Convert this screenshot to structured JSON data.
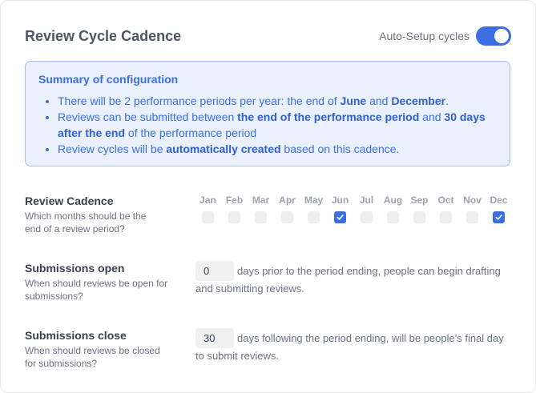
{
  "header": {
    "title": "Review Cycle Cadence",
    "auto_setup_label": "Auto-Setup cycles",
    "auto_setup_on": true
  },
  "summary": {
    "title": "Summary of configuration",
    "line1": {
      "pre": "There will be 2 performance periods per year: the end of ",
      "b1": "June",
      "mid": " and ",
      "b2": "December",
      "post": "."
    },
    "line2": {
      "pre": "Reviews can be submitted between ",
      "b1": "the end of the performance period",
      "mid": " and ",
      "b2": "30 days after the end",
      "post": " of the performance period"
    },
    "line3": {
      "pre": "Review cycles will be ",
      "b1": "automatically created",
      "post": " based on this cadence."
    }
  },
  "cadence": {
    "label": "Review Cadence",
    "sub": "Which months should be the end of a review period?",
    "months": [
      {
        "name": "Jan",
        "checked": false
      },
      {
        "name": "Feb",
        "checked": false
      },
      {
        "name": "Mar",
        "checked": false
      },
      {
        "name": "Apr",
        "checked": false
      },
      {
        "name": "May",
        "checked": false
      },
      {
        "name": "Jun",
        "checked": true
      },
      {
        "name": "Jul",
        "checked": false
      },
      {
        "name": "Aug",
        "checked": false
      },
      {
        "name": "Sep",
        "checked": false
      },
      {
        "name": "Oct",
        "checked": false
      },
      {
        "name": "Nov",
        "checked": false
      },
      {
        "name": "Dec",
        "checked": true
      }
    ]
  },
  "open": {
    "label": "Submissions open",
    "sub": "When should reviews be open for submissions?",
    "value": "0",
    "text": "days prior to the period ending, people can begin drafting and submitting reviews."
  },
  "close": {
    "label": "Submissions close",
    "sub": "When should reviews be closed for submissions?",
    "value": "30",
    "text": "days following the period ending, will be people's final day to submit reviews."
  },
  "colors": {
    "accent": "#3b6fe0",
    "summary_bg": "#eaf0fc",
    "summary_border": "#a9c1f0"
  }
}
